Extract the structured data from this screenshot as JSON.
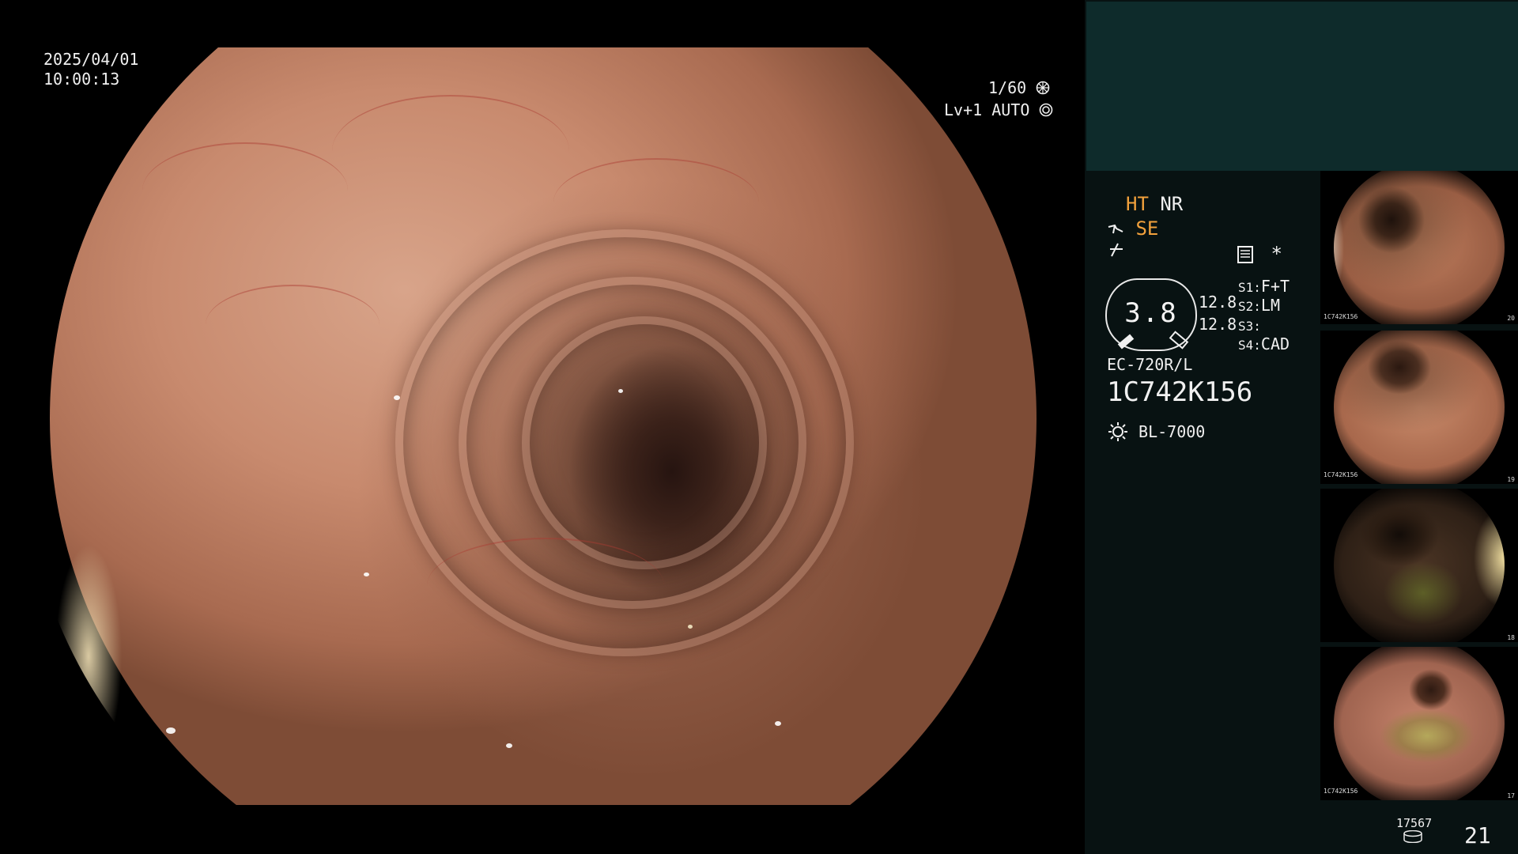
{
  "overlay": {
    "date": "2025/04/01",
    "time": "10:00:13",
    "shutter": "1/60",
    "shutter_icon": "aperture-icon",
    "level": "Lv+1",
    "mode": "AUTO",
    "mode_icon": "iris-icon"
  },
  "settings": {
    "ht": "HT",
    "nr": "NR",
    "se": "SE",
    "se_icon": "tool-icon",
    "freeze_icon": "freeze-icon",
    "memo_icon": "memo-icon",
    "asterisk": "*",
    "zoom": "3.8",
    "zoom_aux_1": "12.8",
    "zoom_aux_2": "12.8",
    "s1_key": "S1:",
    "s1_val": "F+T",
    "s2_key": "S2:",
    "s2_val": "LM",
    "s3_key": "S3:",
    "s3_val": "",
    "s4_key": "S4:",
    "s4_val": "CAD",
    "scope_model": "EC-720R/L",
    "scope_serial": "1C742K156",
    "light_source": "BL-7000",
    "light_icon": "light-source-icon"
  },
  "thumbnails": [
    {
      "label": "1C742K156",
      "index": "20"
    },
    {
      "label": "1C742K156",
      "index": "19"
    },
    {
      "label": "",
      "index": "18"
    },
    {
      "label": "1C742K156",
      "index": "17"
    }
  ],
  "footer": {
    "storage_count": "17567",
    "storage_icon": "storage-icon",
    "image_count": "21"
  },
  "colors": {
    "accent_orange": "#f2a13c",
    "panel_bg": "#081212",
    "teal_block": "#0e2b2b"
  }
}
